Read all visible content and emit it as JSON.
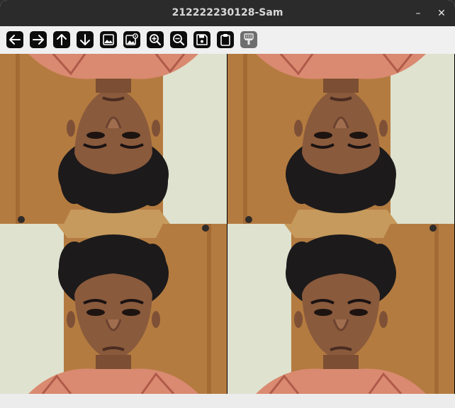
{
  "window": {
    "title": "212222230128-Sam",
    "minimize_glyph": "–",
    "close_glyph": "✕"
  },
  "toolbar": {
    "tools": [
      {
        "icon": "arrow-left-icon"
      },
      {
        "icon": "arrow-right-icon"
      },
      {
        "icon": "arrow-up-icon"
      },
      {
        "icon": "arrow-down-icon"
      },
      {
        "icon": "image-icon"
      },
      {
        "icon": "image-settings-icon"
      },
      {
        "icon": "zoom-in-icon"
      },
      {
        "icon": "zoom-out-icon"
      },
      {
        "icon": "save-icon"
      },
      {
        "icon": "clipboard-icon"
      },
      {
        "icon": "brush-icon",
        "disabled": true
      }
    ]
  },
  "image_grid": {
    "rows": 2,
    "cols": 2,
    "tiles": [
      {
        "orientation": "upside-down"
      },
      {
        "orientation": "upside-down"
      },
      {
        "orientation": "upright"
      },
      {
        "orientation": "upright"
      }
    ]
  },
  "colors": {
    "titlebar": "#2b2b2b",
    "toolbar": "#f0f0f0",
    "tool_button": "#0c0c0c",
    "wall_left": "#b47b40",
    "wall_right": "#dfe2cf"
  }
}
